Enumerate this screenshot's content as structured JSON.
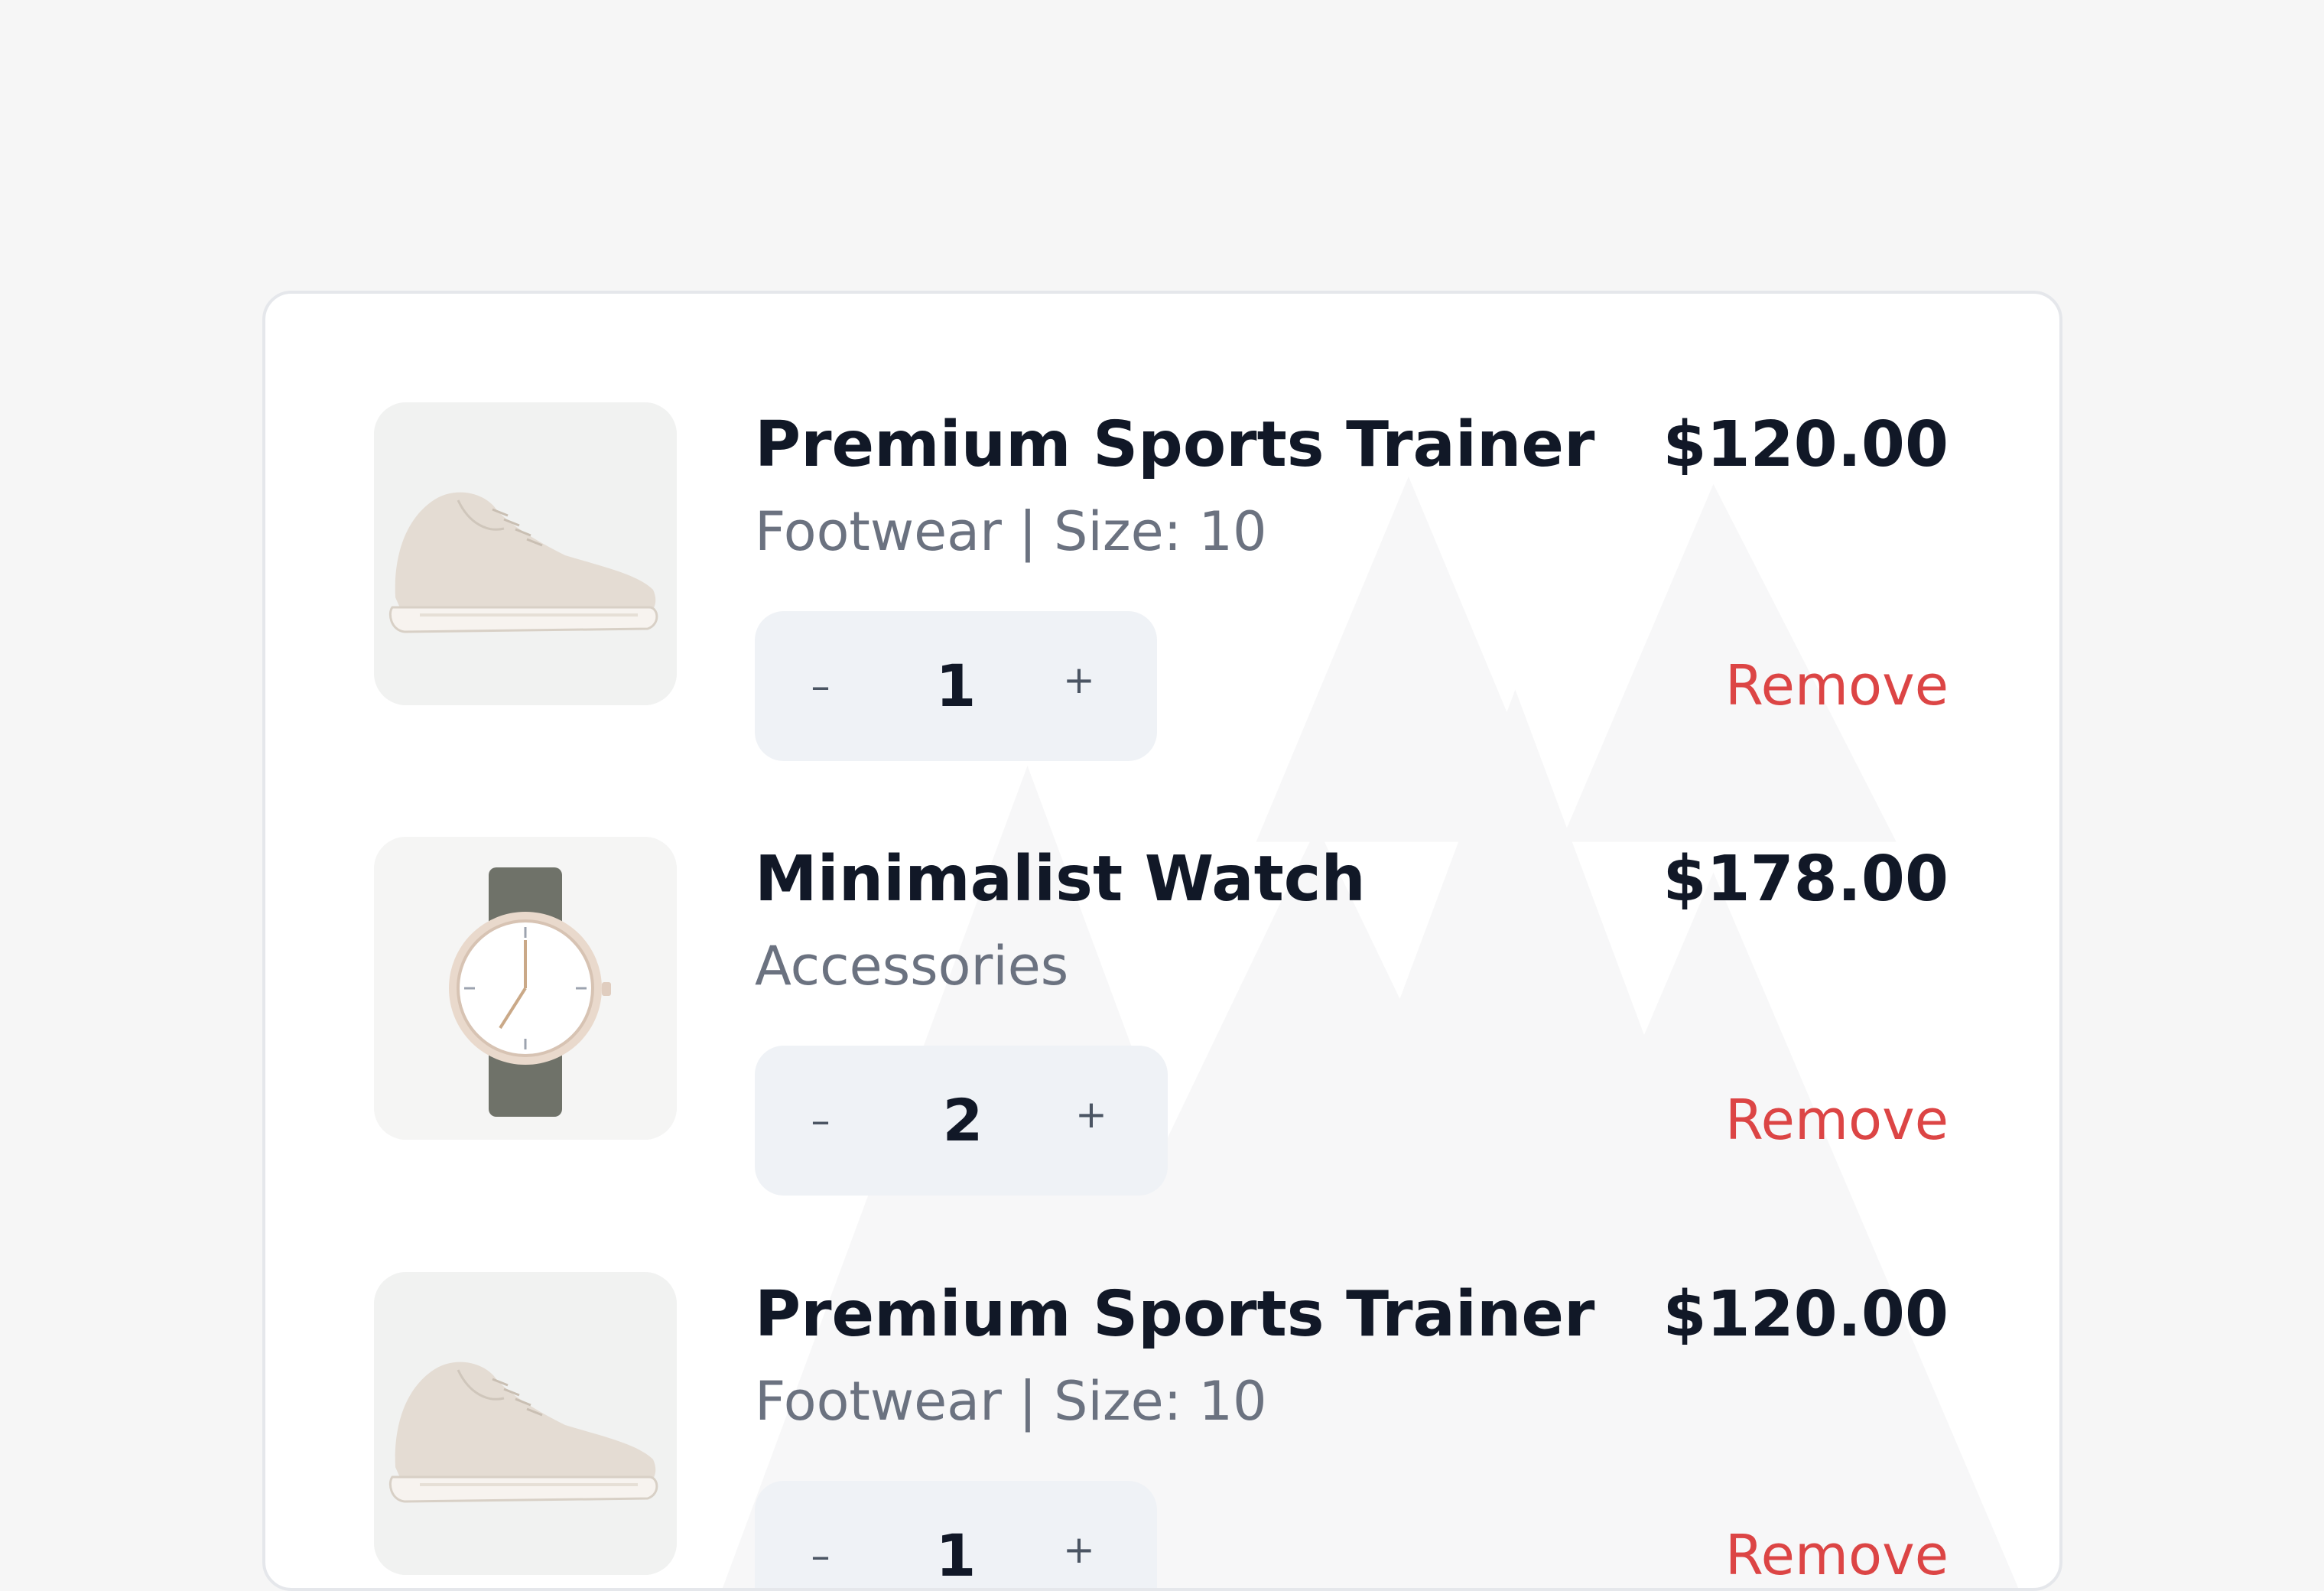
{
  "cart": {
    "items": [
      {
        "name": "Premium Sports Trainer",
        "meta": "Footwear | Size: 10",
        "price": "$120.00",
        "quantity": "1",
        "decrement_label": "–",
        "increment_label": "+",
        "remove_label": "Remove",
        "image": "sneaker-image"
      },
      {
        "name": "Minimalist Watch",
        "meta": "Accessories",
        "price": "$178.00",
        "quantity": "2",
        "decrement_label": "–",
        "increment_label": "+",
        "remove_label": "Remove",
        "image": "watch-image"
      },
      {
        "name": "Premium Sports Trainer",
        "meta": "Footwear | Size: 10",
        "price": "$120.00",
        "quantity": "1",
        "decrement_label": "–",
        "increment_label": "+",
        "remove_label": "Remove",
        "image": "sneaker-image"
      }
    ]
  },
  "colors": {
    "page_background": "#f6f6f6",
    "card_background": "#ffffff",
    "text_primary": "#111827",
    "text_secondary": "#6b7280",
    "remove_red": "#dc4545",
    "stepper_background": "#eff2f6"
  }
}
